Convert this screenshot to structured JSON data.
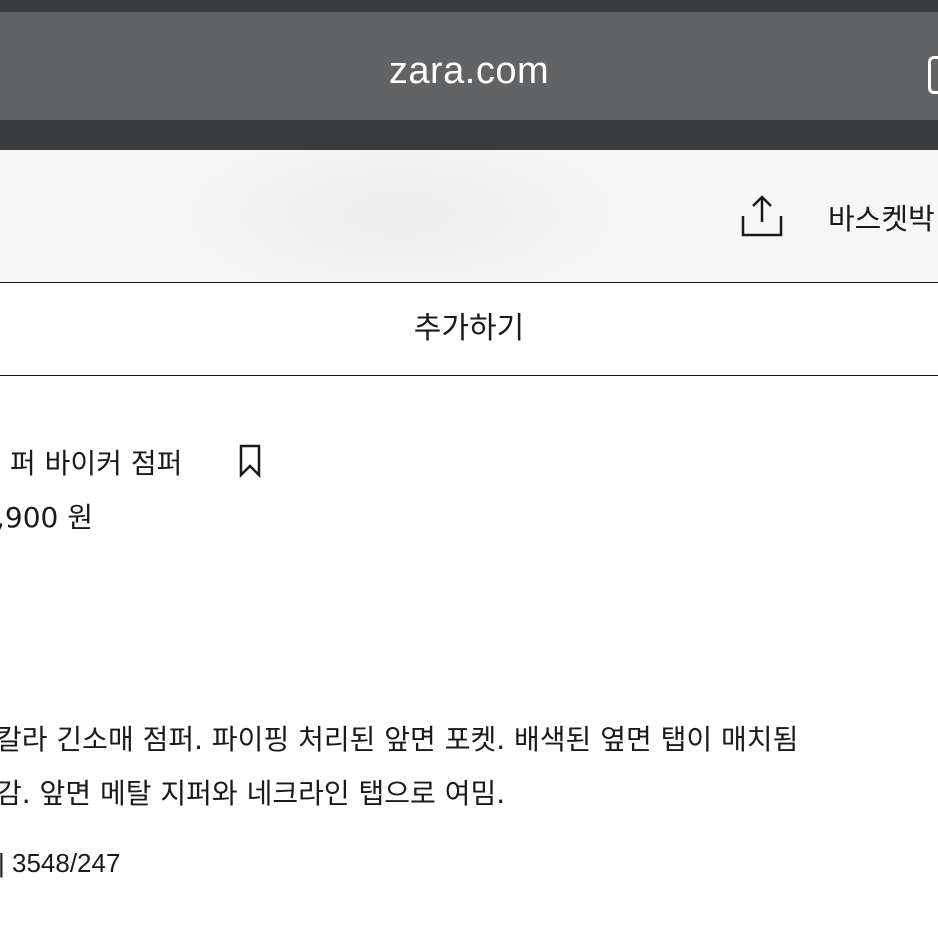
{
  "browser": {
    "address": "zara.com",
    "tabs_icon": "tabs-icon"
  },
  "header": {
    "share_icon": "share-icon",
    "basket_label": "바스켓박"
  },
  "actions": {
    "add_label": "추가하기"
  },
  "product": {
    "name": "퍼 바이커 점퍼",
    "bookmark_icon": "bookmark-icon",
    "price": ",900 원",
    "description": [
      "칼라 긴소매 점퍼. 파이핑 처리된 앞면 포켓. 배색된 옆면 탭이 매치됨",
      "감. 앞면 메탈 지퍼와 네크라인 탭으로 여밈."
    ],
    "reference": "| 3548/247"
  },
  "colors": {
    "chrome_dark": "#3a3c3e",
    "address_bar": "#616365",
    "text": "#1a1a1a"
  }
}
